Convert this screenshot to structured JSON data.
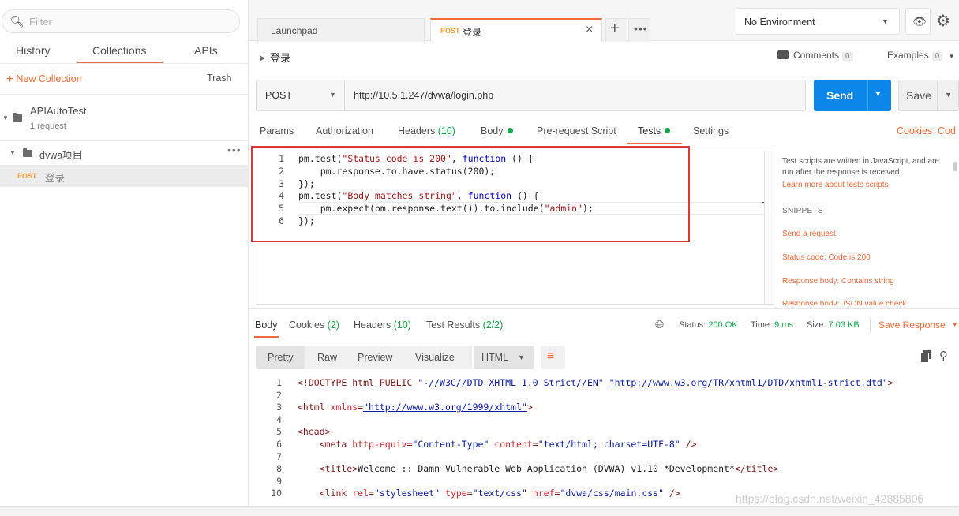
{
  "sidebar": {
    "filter_placeholder": "Filter",
    "tabs": [
      "History",
      "Collections",
      "APIs"
    ],
    "new_collection": "New Collection",
    "trash": "Trash",
    "collection": {
      "name": "APIAutoTest",
      "count": "1 request"
    },
    "folder": {
      "name": "dvwa项目"
    },
    "request": {
      "method": "POST",
      "name": "登录"
    }
  },
  "tabs": {
    "launchpad": "Launchpad",
    "active": {
      "method": "POST",
      "name": "登录"
    }
  },
  "environment": {
    "selected": "No Environment"
  },
  "request": {
    "title": "登录",
    "comments_label": "Comments",
    "comments_count": "0",
    "examples_label": "Examples",
    "examples_count": "0",
    "method": "POST",
    "url": "http://10.5.1.247/dvwa/login.php",
    "send_label": "Send",
    "save_label": "Save",
    "tabs": {
      "params": "Params",
      "authorization": "Authorization",
      "headers": "Headers",
      "headers_count": "(10)",
      "body": "Body",
      "prerequest": "Pre-request Script",
      "tests": "Tests",
      "settings": "Settings"
    },
    "cookies_link": "Cookies",
    "code_link": "Cod"
  },
  "tests_code": [
    {
      "ln": "1",
      "parts": [
        [
          "pm.test(",
          ""
        ],
        [
          "\"Status code is 200\"",
          "str"
        ],
        [
          ", ",
          ""
        ],
        [
          "function",
          "kw"
        ],
        [
          " () {",
          ""
        ]
      ]
    },
    {
      "ln": "2",
      "parts": [
        [
          "    pm.response.to.have.status(200);",
          ""
        ]
      ]
    },
    {
      "ln": "3",
      "parts": [
        [
          "});",
          ""
        ]
      ]
    },
    {
      "ln": "4",
      "parts": [
        [
          "pm.test(",
          ""
        ],
        [
          "\"Body matches string\"",
          "str"
        ],
        [
          ", ",
          ""
        ],
        [
          "function",
          "kw"
        ],
        [
          " () {",
          ""
        ]
      ]
    },
    {
      "ln": "5",
      "parts": [
        [
          "    pm.expect(pm.response.text()).to.include(",
          ""
        ],
        [
          "\"admin\"",
          "str"
        ],
        [
          ");",
          ""
        ]
      ]
    },
    {
      "ln": "6",
      "parts": [
        [
          "});",
          ""
        ]
      ]
    }
  ],
  "snippets": {
    "description": "Test scripts are written in JavaScript, and are run after the response is received.",
    "learn_more": "Learn more about tests scripts",
    "heading": "SNIPPETS",
    "items": [
      "Send a request",
      "Status code: Code is 200",
      "Response body: Contains string",
      "Response body: JSON value check"
    ]
  },
  "response": {
    "tabs": {
      "body": "Body",
      "cookies": "Cookies",
      "cookies_count": "(2)",
      "headers": "Headers",
      "headers_count": "(10)",
      "tests": "Test Results",
      "tests_count": "(2/2)"
    },
    "status_label": "Status:",
    "status_value": "200 OK",
    "time_label": "Time:",
    "time_value": "9 ms",
    "size_label": "Size:",
    "size_value": "7.03 KB",
    "save_response": "Save Response",
    "format_buttons": [
      "Pretty",
      "Raw",
      "Preview",
      "Visualize"
    ],
    "format_selected": "HTML"
  },
  "response_code": [
    {
      "ln": "1",
      "parts": [
        [
          "<!DOCTYPE html PUBLIC ",
          "doc"
        ],
        [
          "\"-//W3C//DTD XHTML 1.0 Strict//EN\"",
          "dval"
        ],
        [
          " ",
          "doc"
        ],
        [
          "\"http://www.w3.org/TR/xhtml1/DTD/xhtml1-strict.dtd\"",
          "url"
        ],
        [
          ">",
          "doc"
        ]
      ]
    },
    {
      "ln": "2",
      "parts": []
    },
    {
      "ln": "3",
      "parts": [
        [
          "<html ",
          "tag"
        ],
        [
          "xmlns",
          "attr"
        ],
        [
          "=",
          "tag"
        ],
        [
          "\"http://www.w3.org/1999/xhtml\"",
          "url"
        ],
        [
          ">",
          "tag"
        ]
      ]
    },
    {
      "ln": "4",
      "parts": []
    },
    {
      "ln": "5",
      "parts": [
        [
          "<head>",
          "tag"
        ]
      ]
    },
    {
      "ln": "6",
      "parts": [
        [
          "    <meta ",
          "tag"
        ],
        [
          "http-equiv",
          "attr"
        ],
        [
          "=",
          "tag"
        ],
        [
          "\"Content-Type\"",
          "aval"
        ],
        [
          " ",
          "tag"
        ],
        [
          "content",
          "attr"
        ],
        [
          "=",
          "tag"
        ],
        [
          "\"text/html; charset=UTF-8\"",
          "aval"
        ],
        [
          " />",
          "tag"
        ]
      ]
    },
    {
      "ln": "7",
      "parts": []
    },
    {
      "ln": "8",
      "parts": [
        [
          "    <title>",
          "tag"
        ],
        [
          "Welcome :: Damn Vulnerable Web Application (DVWA) v1.10 *Development*",
          "txt"
        ],
        [
          "</title>",
          "tag"
        ]
      ]
    },
    {
      "ln": "9",
      "parts": []
    },
    {
      "ln": "10",
      "parts": [
        [
          "    <link ",
          "tag"
        ],
        [
          "rel",
          "attr"
        ],
        [
          "=",
          "tag"
        ],
        [
          "\"stylesheet\"",
          "aval"
        ],
        [
          " ",
          "tag"
        ],
        [
          "type",
          "attr"
        ],
        [
          "=",
          "tag"
        ],
        [
          "\"text/css\"",
          "aval"
        ],
        [
          " ",
          "tag"
        ],
        [
          "href",
          "attr"
        ],
        [
          "=",
          "tag"
        ],
        [
          "\"dvwa/css/main.css\"",
          "aval"
        ],
        [
          " />",
          "tag"
        ]
      ]
    }
  ],
  "watermark": "https://blog.csdn.net/weixin_42885806"
}
